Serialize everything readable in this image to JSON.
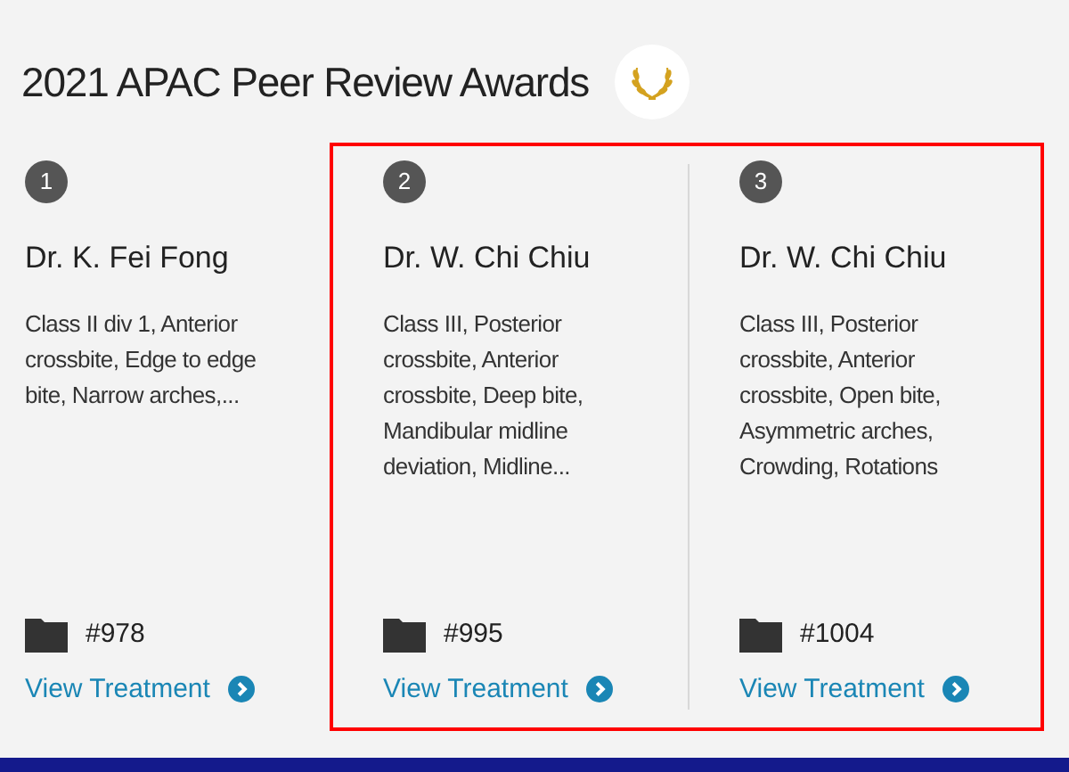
{
  "title": "2021 APAC Peer Review Awards",
  "cards": [
    {
      "rank": "1",
      "name": "Dr. K. Fei Fong",
      "description": "Class II div 1, Anterior crossbite, Edge to edge bite, Narrow arches,...",
      "case_number": "#978",
      "link": "View Treatment",
      "highlighted": false
    },
    {
      "rank": "2",
      "name": "Dr. W. Chi Chiu",
      "description": "Class III, Posterior crossbite, Anterior crossbite, Deep bite, Mandibular midline deviation, Midline...",
      "case_number": "#995",
      "link": "View Treatment",
      "highlighted": true
    },
    {
      "rank": "3",
      "name": "Dr. W. Chi Chiu",
      "description": "Class III, Posterior crossbite, Anterior crossbite, Open bite, Asymmetric arches, Crowding, Rotations",
      "case_number": "#1004",
      "link": "View Treatment",
      "highlighted": true
    }
  ]
}
